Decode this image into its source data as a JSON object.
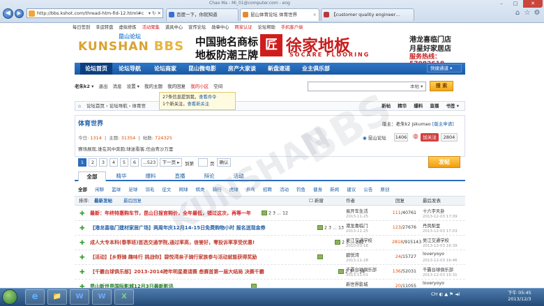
{
  "browser": {
    "window_title": "Chao Ma - Mi_01@computer.com - eng",
    "address": "http://bbs.kshot.com/thread-htm-fid-12.html#c",
    "address_tools": "▾ ↻ ✕",
    "tabs": [
      {
        "label": "百度一下，你就知道",
        "icon_color": "#3a6fd8"
      },
      {
        "label": "昆山体育论坛 体育世界",
        "icon_color": "#e58a2a"
      },
      {
        "label": "【customer quality engineer…",
        "icon_color": "#b43a3a"
      }
    ],
    "window_controls": [
      "–",
      "□",
      "✕"
    ]
  },
  "toplinks": [
    "每日签到",
    "幸运转盘",
    "虚拟修炼",
    "活动聚集",
    "道具中心",
    "宣传论坛",
    "勋章中心",
    "两家认证",
    "论坛帮助",
    "手机客户端"
  ],
  "header": {
    "logo_cn": "昆山论坛",
    "logo_en": "KUNSHAN",
    "logo_bbs": "BBS",
    "ad": {
      "line1": "中国驰名商标",
      "line2": "地板防潮王牌",
      "logo_char": "匠",
      "brand": "徐家地板",
      "brand_en": "SOCARE FLOORING",
      "right1": "港龙喜临门店",
      "right2": "月星好家居店",
      "phone": "服务热线：57082618"
    }
  },
  "navbar": {
    "items": [
      "论坛首页",
      "论坛导航",
      "论坛商家",
      "昆山微电影",
      "房产大家谈",
      "新盘速递",
      "业主俱乐部"
    ],
    "quick": "快捷通道 ▾"
  },
  "userbar": {
    "items": [
      "老朱k2 ▾",
      "退出",
      "消息",
      "设置 ▾",
      "我的主题",
      "我的回复",
      "我的小区",
      "空间"
    ],
    "search_scope": "本帖 ▾",
    "search_button": "搜 索"
  },
  "notice": {
    "line1": "27条信息提到我，",
    "line1_link": "查看命令",
    "line2": "1个新关注，",
    "line2_link": "查看新关注"
  },
  "breadcrumb": {
    "items": [
      "论坛首页",
      "论坛导航",
      "体育世"
    ],
    "right": [
      "新帖",
      "精华",
      "爆料",
      "直播",
      "书签 ▾"
    ]
  },
  "forum": {
    "title": "体育世界",
    "moderators": "版主：老朱k2 jskumao",
    "mod_apply": "[版主申请]",
    "stats": {
      "today_label": "今日:",
      "today": "1314",
      "topics_label": "主题:",
      "topics": "31354",
      "posts_label": "帖数:",
      "posts": "724325"
    },
    "desc": "赛场展现,谁在风中奔跑;球迷看客,任由青沙万里",
    "weibo": "昆山论坛",
    "weibo_count": "1406",
    "follow": "加关注",
    "follow_count": "2804"
  },
  "pager": {
    "pages": [
      "1",
      "2",
      "3",
      "4",
      "5",
      "6",
      "...523",
      "下一页 ▸",
      "到第",
      "页",
      "确认"
    ],
    "post_button": "发帖"
  },
  "tabs": [
    "全部",
    "精华",
    "爆料",
    "直播",
    "辩论",
    "活动"
  ],
  "subtabs": [
    "全部",
    "闲聊",
    "篮球",
    "足球",
    "羽毛",
    "征文",
    "网球",
    "棋类",
    "骑行",
    "虎球",
    "乒乓",
    "招聘",
    "活动",
    "钓鱼",
    "健身",
    "新闻",
    "建议",
    "公告",
    "原创"
  ],
  "thead": {
    "sort": "排序:",
    "newest": "最新发帖",
    "last": "最后回复",
    "new_label": "新窗",
    "author": "作者",
    "replies": "回复",
    "last_post": "最后发表"
  },
  "rows": [
    {
      "title": "最新：年终特惠购车节，昆山日报官购价，全年最低，错过这次，再等一年",
      "pages": "2 3 ... 12",
      "color": "#d62020",
      "author": "易开车生活",
      "date": "2013-11-25",
      "replies": "111",
      "views": "40761",
      "last_user": "十六字天卦",
      "last_date": "2013-12-03 17:09"
    },
    {
      "title": "【港龙喜临门建材家居广场】两周年庆12月14-15日免费购物小时 报名送现金券",
      "pages": "2 3 ... 13",
      "color": "#1c5ea6",
      "author": "港龙喜临门",
      "date": "2013-11-25",
      "replies": "123",
      "views": "27676",
      "last_user": "丹凤梨里",
      "last_date": "2013-12-03 17:03"
    },
    {
      "title": "成人大专本科(春季班)首选交通学院,通过率高，信誉好，零投诉率享受优惠!",
      "pages": "2 3 ... 282",
      "color": "#c0392b",
      "author": "吴江交通学校",
      "date": "2010-03-16",
      "replies": "2818",
      "views": "915143",
      "last_user": "吴江交通学校",
      "last_date": "2013-12-03 16:39"
    },
    {
      "title": "【活动】【乡野骑 趣味行 挑战你】碧悦湾亲子骑行家族参与活动就能获得奖励",
      "pages": "",
      "color": "#c0392b",
      "author": "碧悦湾",
      "date": "2013-11-28",
      "replies": "24",
      "views": "15727",
      "last_user": "loveryoyo",
      "last_date": "2013-12-03 16:46"
    },
    {
      "title": "【千霸台球俱乐部】2013-2014跨年明星邀请赛 叁赛首第一届大结局 决赛千霸",
      "pages": "2 3 ... 14",
      "color": "#c0392b",
      "author": "千霸台球俱乐部",
      "date": "2013-11-01",
      "replies": "136",
      "views": "52031",
      "last_user": "千霸台球俱乐部",
      "last_date": "2013-12-03 15:31"
    },
    {
      "title": "昆山新世界国际影城12月3日最新影讯",
      "pages": "",
      "color": "#1f7a1f",
      "author": "新世界影城",
      "date": "2013-11-23",
      "replies": "20",
      "views": "11055",
      "last_user": "loveryoyo",
      "last_date": "2013-12-03 15:07"
    }
  ],
  "taskbar": {
    "apps": [
      "e",
      "📁",
      "W",
      "W",
      "X"
    ],
    "tray": "CH ◐ ▲ ⚑ ◄)",
    "time": "下午 05:45",
    "date": "2013/12/3"
  }
}
